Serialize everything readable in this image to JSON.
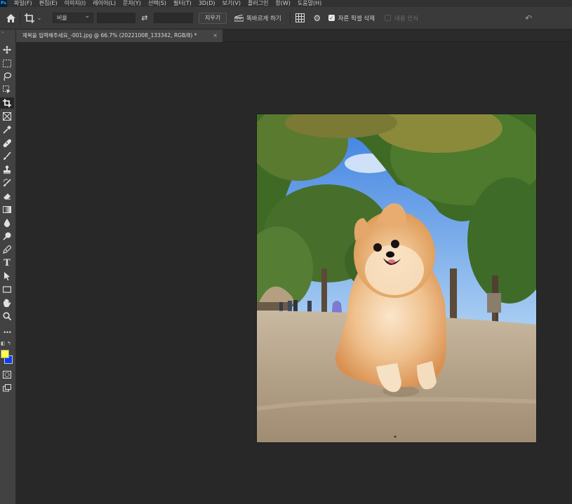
{
  "menubar": {
    "logo": "Ps",
    "items": [
      "파일(F)",
      "편집(E)",
      "이미지(I)",
      "레이어(L)",
      "문자(Y)",
      "선택(S)",
      "필터(T)",
      "3D(D)",
      "보기(V)",
      "플러그인",
      "창(W)",
      "도움말(H)"
    ]
  },
  "options": {
    "ratio_select": "비율",
    "ratio_width_value": "",
    "ratio_height_value": "",
    "clear_label": "지우기",
    "straighten_label": "똑바르게 하기",
    "delete_cropped_label": "자른 픽셀 삭제",
    "delete_cropped_checked": true,
    "content_aware_label": "내용 인식",
    "content_aware_checked": false
  },
  "document": {
    "tab_title": "제목을 입력해주세요_-001.jpg @ 66.7% (20221008_133342, RGB/8) *",
    "close_glyph": "×"
  },
  "colors": {
    "foreground": "#ffff4a",
    "background": "#0a3cf5",
    "ui_panel": "#424242",
    "workspace": "#282828"
  },
  "toolbar": {
    "tools": [
      "move-tool",
      "marquee-tool",
      "lasso-tool",
      "object-select-tool",
      "crop-tool",
      "frame-tool",
      "eyedropper-tool",
      "healing-brush-tool",
      "brush-tool",
      "clone-stamp-tool",
      "history-brush-tool",
      "eraser-tool",
      "gradient-tool",
      "blur-tool",
      "dodge-tool",
      "pen-tool",
      "type-tool",
      "path-selection-tool",
      "rectangle-tool",
      "hand-tool",
      "zoom-tool",
      "more-tools"
    ],
    "type_tool_glyph": "T",
    "more_glyph": "•••"
  }
}
